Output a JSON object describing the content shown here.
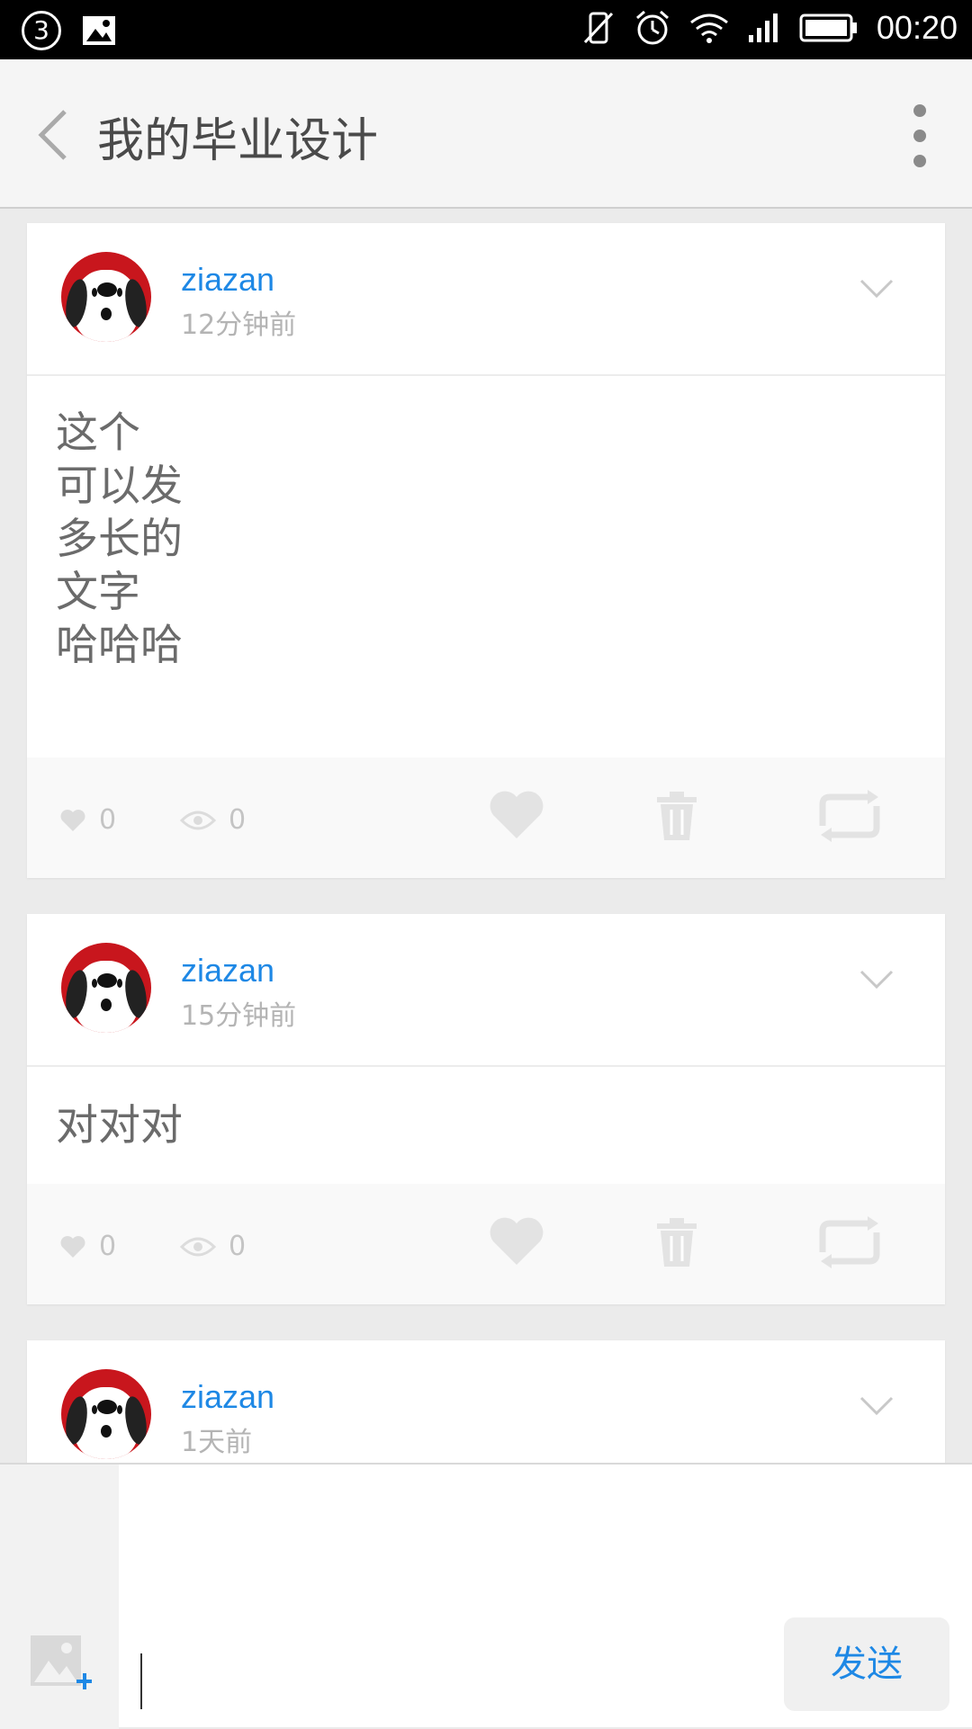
{
  "status_bar": {
    "notification_count": "3",
    "time": "00:20",
    "icons": [
      "notification-badge",
      "image-icon",
      "mute-icon",
      "alarm-icon",
      "wifi-icon",
      "signal-icon",
      "battery-icon"
    ]
  },
  "header": {
    "title": "我的毕业设计",
    "icons": [
      "back-arrow-icon",
      "more-vertical-icon"
    ]
  },
  "posts": [
    {
      "username": "ziazan",
      "time": "12分钟前",
      "content": "这个\n可以发\n多长的\n文字\n哈哈哈",
      "likes": "0",
      "views": "0"
    },
    {
      "username": "ziazan",
      "time": "15分钟前",
      "content": "对对对",
      "likes": "0",
      "views": "0"
    },
    {
      "username": "ziazan",
      "time": "1天前"
    }
  ],
  "composer": {
    "input_value": "",
    "send_label": "发送"
  },
  "colors": {
    "accent": "#1e88e5",
    "background": "#ebebeb",
    "card": "#ffffff",
    "icon_muted": "#dedede"
  }
}
